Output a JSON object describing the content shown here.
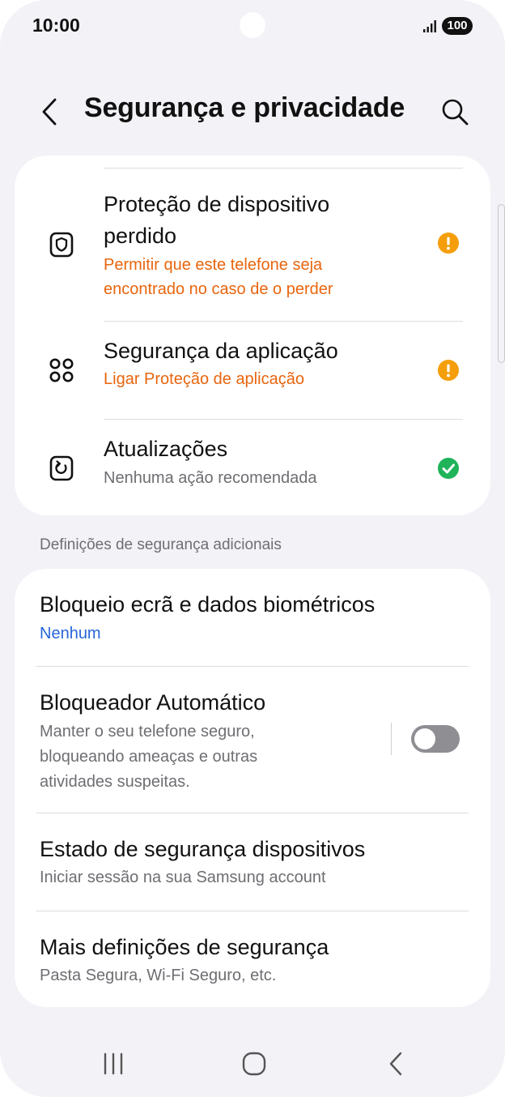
{
  "status_bar": {
    "time": "10:00",
    "battery": "100",
    "signal_icon": "signal-icon"
  },
  "header": {
    "title": "Segurança e privacidade",
    "back_icon": "chevron-left-icon",
    "search_icon": "search-icon"
  },
  "security_status": {
    "items": [
      {
        "title_line1": "Proteção de dispositivo",
        "title_line2": "perdido",
        "sub_line1": "Permitir que este telefone seja",
        "sub_line2": "encontrado no caso de o perder",
        "icon": "shield-icon",
        "status": "warning",
        "status_color": "#f59e0b"
      },
      {
        "title": "Segurança da aplicação",
        "subtitle": "Ligar Proteção de aplicação",
        "icon": "apps-grid-icon",
        "status": "warning",
        "status_color": "#f59e0b"
      },
      {
        "title": "Atualizações",
        "subtitle": "Nenhuma ação recomendada",
        "icon": "update-icon",
        "status": "ok",
        "status_color": "#1fb35a"
      }
    ]
  },
  "additional": {
    "section_label": "Definições de segurança adicionais",
    "items": [
      {
        "title": "Bloqueio ecrã e dados biométricos",
        "subtitle": "Nenhum"
      },
      {
        "title": "Bloqueador Automático",
        "sub_line1": "Manter o seu telefone seguro,",
        "sub_line2": "bloqueando ameaças e outras",
        "sub_line3": "atividades suspeitas.",
        "toggle_on": false
      },
      {
        "title": "Estado de segurança dispositivos",
        "subtitle": "Iniciar sessão na sua Samsung account"
      },
      {
        "title": "Mais definições de segurança",
        "subtitle": "Pasta Segura, Wi-Fi Seguro, etc."
      }
    ]
  },
  "colors": {
    "warning_text": "#e8650e",
    "link_blue": "#2766d8",
    "background": "#f2f2f7"
  },
  "nav_bar": {
    "recents_icon": "recents-icon",
    "home_icon": "home-icon",
    "back_icon": "back-icon"
  }
}
